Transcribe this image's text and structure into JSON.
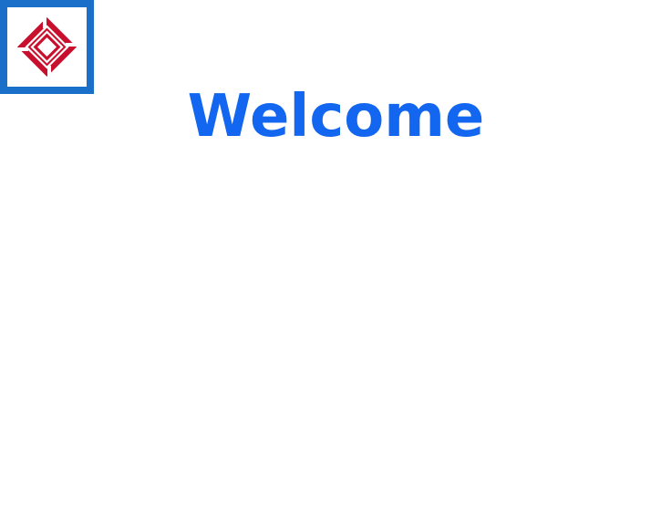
{
  "brand": {
    "logo_icon": "bank-diamond-logo-icon",
    "frame_color": "#1a6fc9",
    "logo_color": "#c8102e"
  },
  "main": {
    "title": "Welcome",
    "title_color": "#1366ef"
  }
}
